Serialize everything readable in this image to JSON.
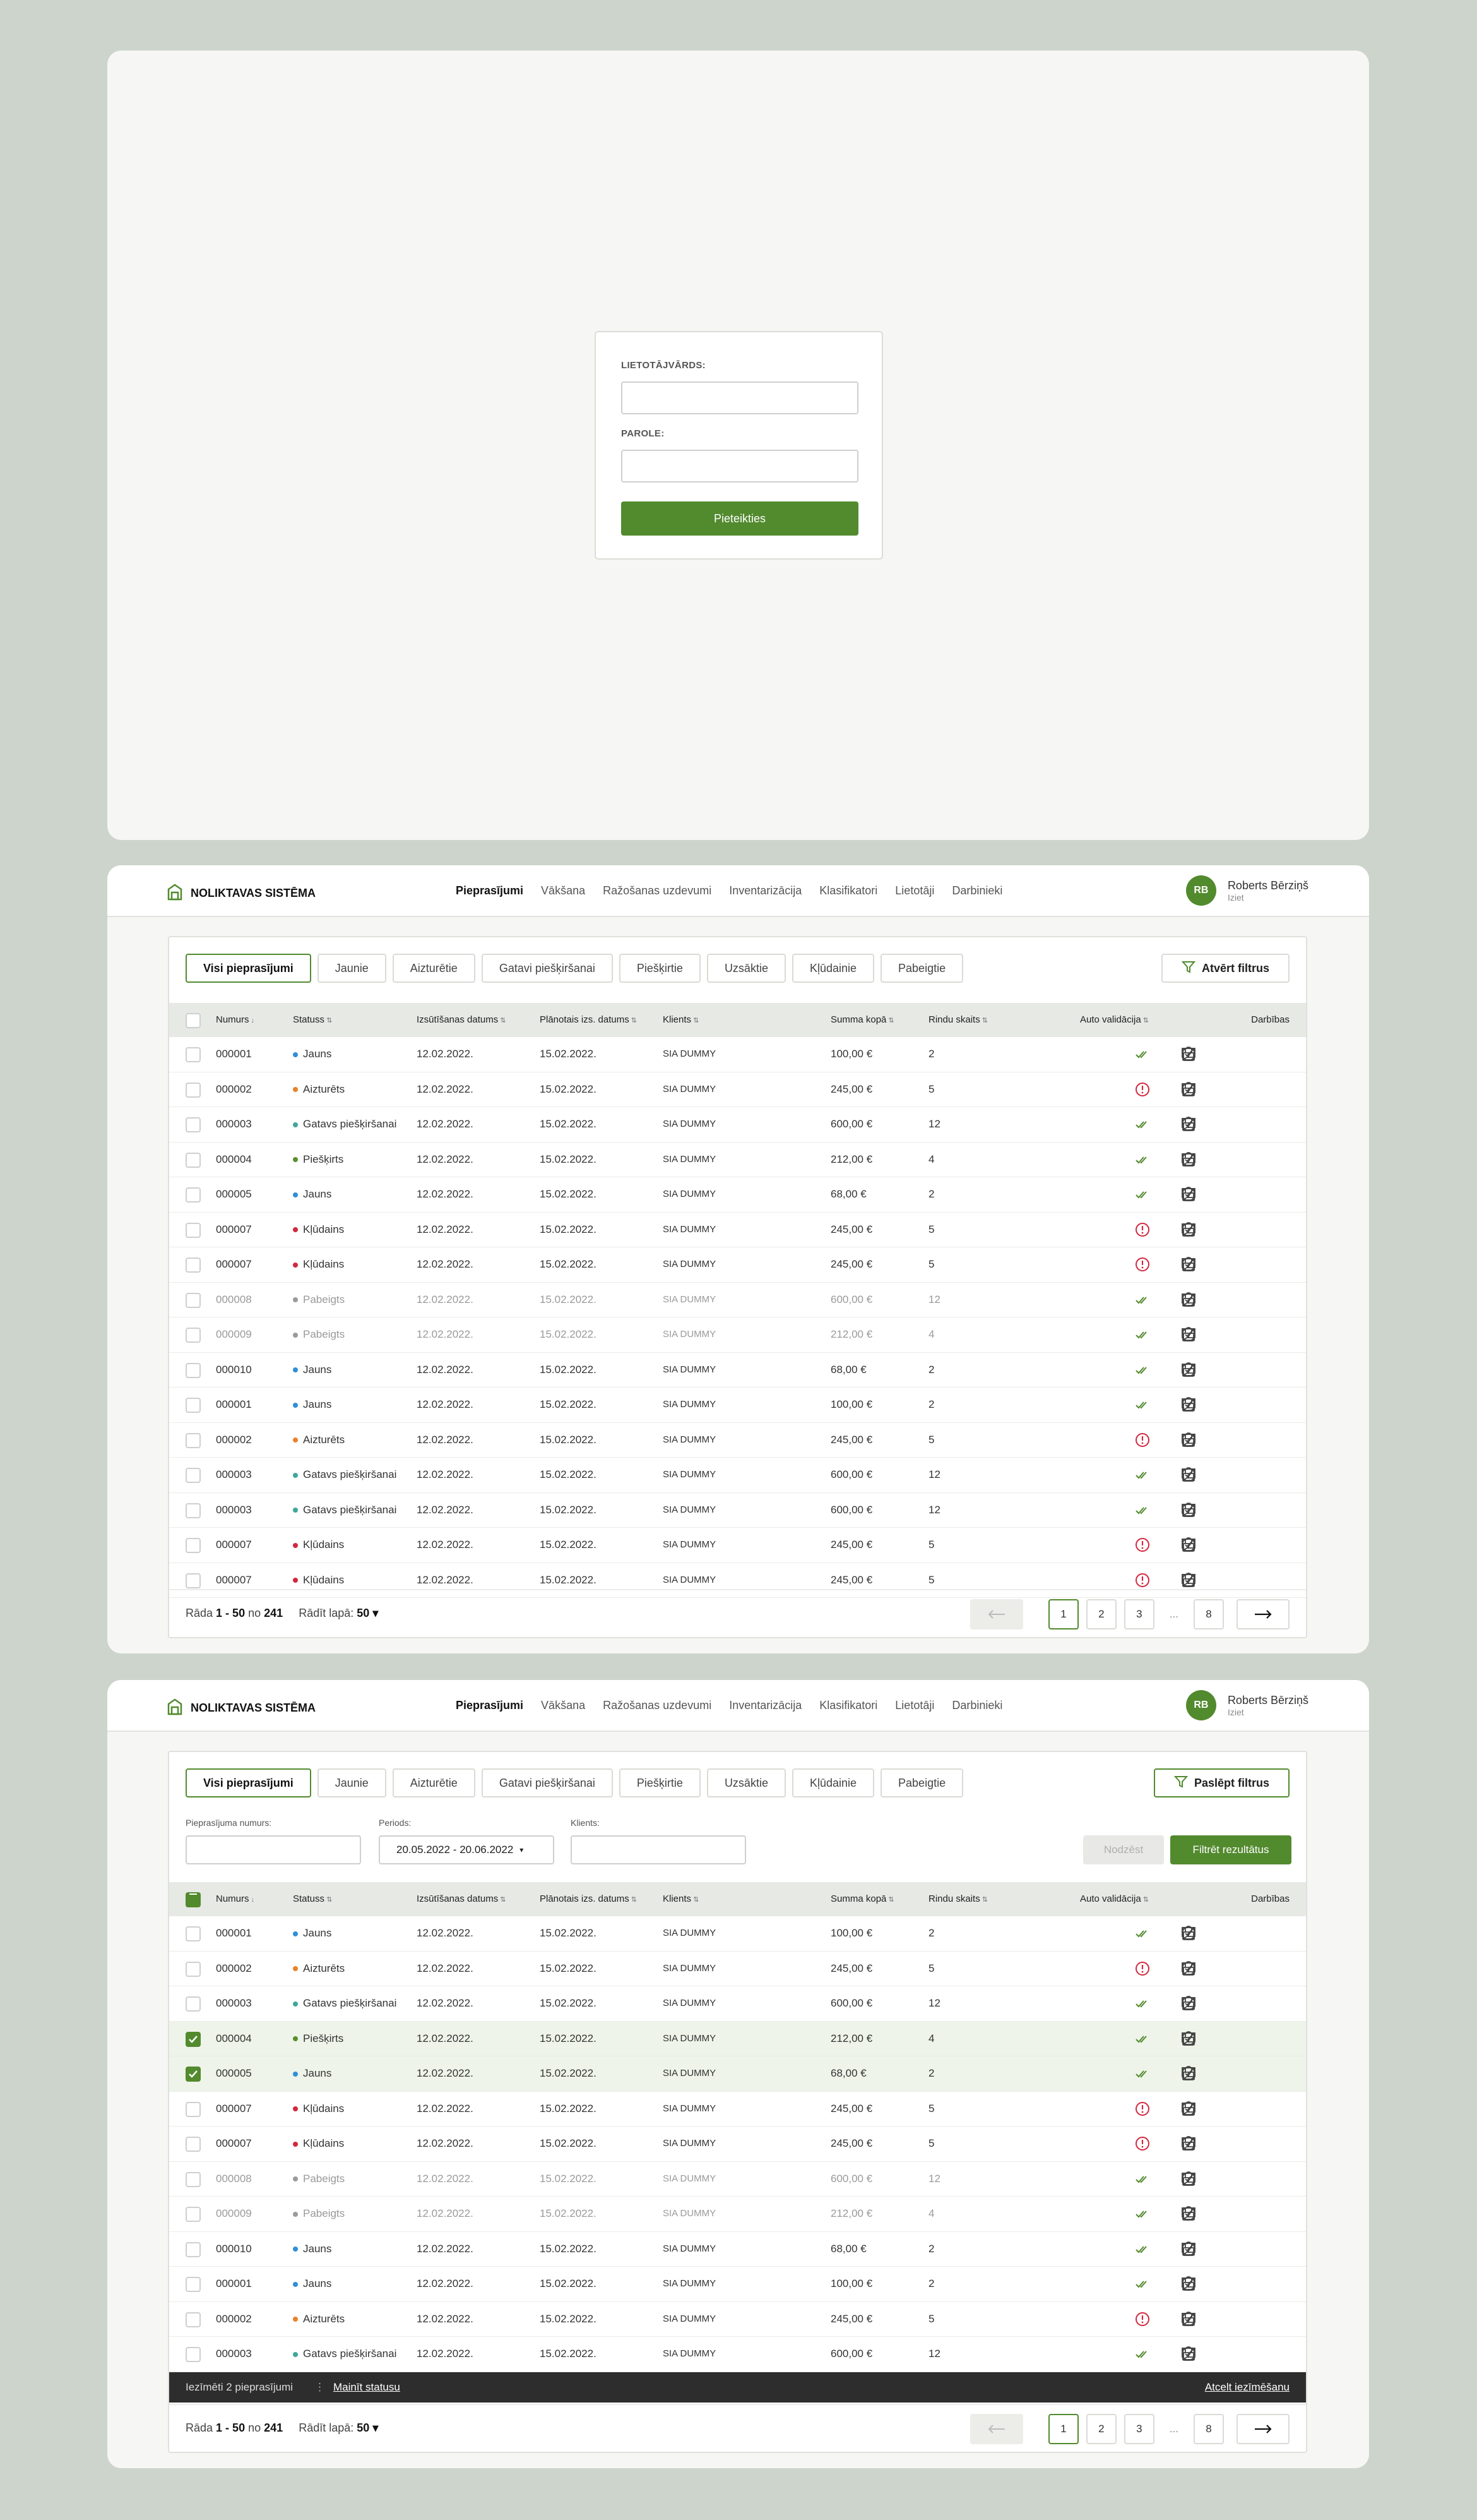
{
  "login": {
    "username_label": "LIETOTĀJVĀRDS:",
    "password_label": "PAROLE:",
    "submit_label": "Pieteikties",
    "username_value": "",
    "password_value": ""
  },
  "header": {
    "brand": "NOLIKTAVAS SISTĒMA",
    "nav": [
      "Pieprasījumi",
      "Vākšana",
      "Ražošanas uzdevumi",
      "Inventarizācija",
      "Klasifikatori",
      "Lietotāji",
      "Darbinieki"
    ],
    "nav_active": 0,
    "user_initials": "RB",
    "user_name": "Roberts Bērziņš",
    "logout": "Iziet"
  },
  "tabs": [
    "Visi pieprasījumi",
    "Jaunie",
    "Aizturētie",
    "Gatavi piešķiršanai",
    "Piešķirtie",
    "Uzsāktie",
    "Kļūdainie",
    "Pabeigtie"
  ],
  "filter_open_label": "Atvērt filtrus",
  "filter_hide_label": "Paslēpt filtrus",
  "filters": {
    "number_label": "Pieprasījuma numurs:",
    "number_value": "",
    "period_label": "Periods:",
    "period_value": "20.05.2022 - 20.06.2022",
    "client_label": "Klients:",
    "client_value": "",
    "clear_label": "Nodzēst",
    "apply_label": "Filtrēt rezultātus"
  },
  "columns": {
    "number": "Numurs",
    "status": "Statuss",
    "issue_date": "Izsūtīšanas datums",
    "planned_date": "Plānotais izs. datums",
    "client": "Klients",
    "sum": "Summa kopā",
    "rows": "Rindu skaits",
    "auto": "Auto validācija",
    "actions": "Darbības"
  },
  "status_colors": {
    "Jauns": "#2f8fd8",
    "Aizturēts": "#e8822a",
    "Gatavs piešķiršanai": "#3fa79a",
    "Piešķirts": "#5a8f2e",
    "Kļūdains": "#d2283e",
    "Pabeigts": "#9a9a9a"
  },
  "table1_rows": [
    {
      "n": "000001",
      "s": "Jauns",
      "d1": "12.02.2022.",
      "d2": "15.02.2022.",
      "c": "SIA DUMMY",
      "sum": "100,00 €",
      "r": "2",
      "v": "ok"
    },
    {
      "n": "000002",
      "s": "Aizturēts",
      "d1": "12.02.2022.",
      "d2": "15.02.2022.",
      "c": "SIA DUMMY",
      "sum": "245,00 €",
      "r": "5",
      "v": "err"
    },
    {
      "n": "000003",
      "s": "Gatavs piešķiršanai",
      "d1": "12.02.2022.",
      "d2": "15.02.2022.",
      "c": "SIA DUMMY",
      "sum": "600,00 €",
      "r": "12",
      "v": "ok"
    },
    {
      "n": "000004",
      "s": "Piešķirts",
      "d1": "12.02.2022.",
      "d2": "15.02.2022.",
      "c": "SIA DUMMY",
      "sum": "212,00 €",
      "r": "4",
      "v": "ok"
    },
    {
      "n": "000005",
      "s": "Jauns",
      "d1": "12.02.2022.",
      "d2": "15.02.2022.",
      "c": "SIA DUMMY",
      "sum": "68,00 €",
      "r": "2",
      "v": "ok"
    },
    {
      "n": "000007",
      "s": "Kļūdains",
      "d1": "12.02.2022.",
      "d2": "15.02.2022.",
      "c": "SIA DUMMY",
      "sum": "245,00 €",
      "r": "5",
      "v": "err"
    },
    {
      "n": "000007",
      "s": "Kļūdains",
      "d1": "12.02.2022.",
      "d2": "15.02.2022.",
      "c": "SIA DUMMY",
      "sum": "245,00 €",
      "r": "5",
      "v": "err"
    },
    {
      "n": "000008",
      "s": "Pabeigts",
      "d1": "12.02.2022.",
      "d2": "15.02.2022.",
      "c": "SIA DUMMY",
      "sum": "600,00 €",
      "r": "12",
      "v": "ok"
    },
    {
      "n": "000009",
      "s": "Pabeigts",
      "d1": "12.02.2022.",
      "d2": "15.02.2022.",
      "c": "SIA DUMMY",
      "sum": "212,00 €",
      "r": "4",
      "v": "ok"
    },
    {
      "n": "000010",
      "s": "Jauns",
      "d1": "12.02.2022.",
      "d2": "15.02.2022.",
      "c": "SIA DUMMY",
      "sum": "68,00 €",
      "r": "2",
      "v": "ok"
    },
    {
      "n": "000001",
      "s": "Jauns",
      "d1": "12.02.2022.",
      "d2": "15.02.2022.",
      "c": "SIA DUMMY",
      "sum": "100,00 €",
      "r": "2",
      "v": "ok"
    },
    {
      "n": "000002",
      "s": "Aizturēts",
      "d1": "12.02.2022.",
      "d2": "15.02.2022.",
      "c": "SIA DUMMY",
      "sum": "245,00 €",
      "r": "5",
      "v": "err"
    },
    {
      "n": "000003",
      "s": "Gatavs piešķiršanai",
      "d1": "12.02.2022.",
      "d2": "15.02.2022.",
      "c": "SIA DUMMY",
      "sum": "600,00 €",
      "r": "12",
      "v": "ok"
    },
    {
      "n": "000003",
      "s": "Gatavs piešķiršanai",
      "d1": "12.02.2022.",
      "d2": "15.02.2022.",
      "c": "SIA DUMMY",
      "sum": "600,00 €",
      "r": "12",
      "v": "ok"
    },
    {
      "n": "000007",
      "s": "Kļūdains",
      "d1": "12.02.2022.",
      "d2": "15.02.2022.",
      "c": "SIA DUMMY",
      "sum": "245,00 €",
      "r": "5",
      "v": "err"
    },
    {
      "n": "000007",
      "s": "Kļūdains",
      "d1": "12.02.2022.",
      "d2": "15.02.2022.",
      "c": "SIA DUMMY",
      "sum": "245,00 €",
      "r": "5",
      "v": "err"
    }
  ],
  "table2_rows": [
    {
      "n": "000001",
      "s": "Jauns",
      "d1": "12.02.2022.",
      "d2": "15.02.2022.",
      "c": "SIA DUMMY",
      "sum": "100,00 €",
      "r": "2",
      "v": "ok",
      "sel": false
    },
    {
      "n": "000002",
      "s": "Aizturēts",
      "d1": "12.02.2022.",
      "d2": "15.02.2022.",
      "c": "SIA DUMMY",
      "sum": "245,00 €",
      "r": "5",
      "v": "err",
      "sel": false
    },
    {
      "n": "000003",
      "s": "Gatavs piešķiršanai",
      "d1": "12.02.2022.",
      "d2": "15.02.2022.",
      "c": "SIA DUMMY",
      "sum": "600,00 €",
      "r": "12",
      "v": "ok",
      "sel": false
    },
    {
      "n": "000004",
      "s": "Piešķirts",
      "d1": "12.02.2022.",
      "d2": "15.02.2022.",
      "c": "SIA DUMMY",
      "sum": "212,00 €",
      "r": "4",
      "v": "ok",
      "sel": true
    },
    {
      "n": "000005",
      "s": "Jauns",
      "d1": "12.02.2022.",
      "d2": "15.02.2022.",
      "c": "SIA DUMMY",
      "sum": "68,00 €",
      "r": "2",
      "v": "ok",
      "sel": true
    },
    {
      "n": "000007",
      "s": "Kļūdains",
      "d1": "12.02.2022.",
      "d2": "15.02.2022.",
      "c": "SIA DUMMY",
      "sum": "245,00 €",
      "r": "5",
      "v": "err",
      "sel": false
    },
    {
      "n": "000007",
      "s": "Kļūdains",
      "d1": "12.02.2022.",
      "d2": "15.02.2022.",
      "c": "SIA DUMMY",
      "sum": "245,00 €",
      "r": "5",
      "v": "err",
      "sel": false
    },
    {
      "n": "000008",
      "s": "Pabeigts",
      "d1": "12.02.2022.",
      "d2": "15.02.2022.",
      "c": "SIA DUMMY",
      "sum": "600,00 €",
      "r": "12",
      "v": "ok",
      "sel": false
    },
    {
      "n": "000009",
      "s": "Pabeigts",
      "d1": "12.02.2022.",
      "d2": "15.02.2022.",
      "c": "SIA DUMMY",
      "sum": "212,00 €",
      "r": "4",
      "v": "ok",
      "sel": false
    },
    {
      "n": "000010",
      "s": "Jauns",
      "d1": "12.02.2022.",
      "d2": "15.02.2022.",
      "c": "SIA DUMMY",
      "sum": "68,00 €",
      "r": "2",
      "v": "ok",
      "sel": false
    },
    {
      "n": "000001",
      "s": "Jauns",
      "d1": "12.02.2022.",
      "d2": "15.02.2022.",
      "c": "SIA DUMMY",
      "sum": "100,00 €",
      "r": "2",
      "v": "ok",
      "sel": false
    },
    {
      "n": "000002",
      "s": "Aizturēts",
      "d1": "12.02.2022.",
      "d2": "15.02.2022.",
      "c": "SIA DUMMY",
      "sum": "245,00 €",
      "r": "5",
      "v": "err",
      "sel": false
    },
    {
      "n": "000003",
      "s": "Gatavs piešķiršanai",
      "d1": "12.02.2022.",
      "d2": "15.02.2022.",
      "c": "SIA DUMMY",
      "sum": "600,00 €",
      "r": "12",
      "v": "ok",
      "sel": false
    }
  ],
  "pagination": {
    "prefix": "Rāda",
    "range": "1 - 50",
    "of": "no",
    "total": "241",
    "per_page_label": "Rādīt lapā:",
    "per_page": "50",
    "pages": [
      "1",
      "2",
      "3",
      "...",
      "8"
    ],
    "current_page": "1"
  },
  "selection_bar": {
    "count_text": "Iezīmēti 2 pieprasījumi",
    "change_status": "Mainīt statusu",
    "clear": "Atcelt iezīmēšanu"
  }
}
